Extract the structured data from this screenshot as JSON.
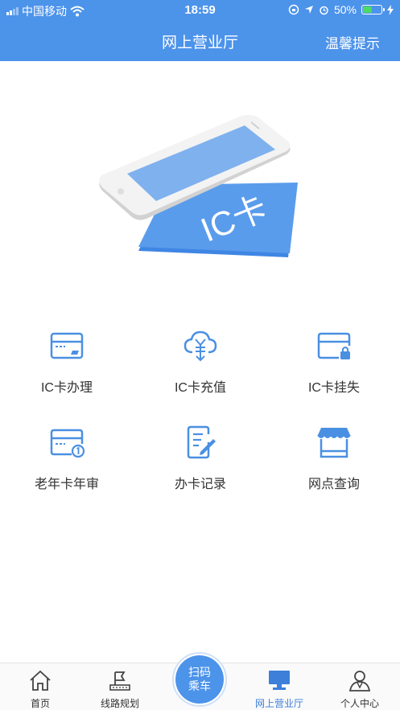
{
  "status_bar": {
    "carrier": "中国移动",
    "time": "18:59",
    "battery": "50%",
    "battery_level": 0.5
  },
  "header": {
    "title": "网上营业厅",
    "tip_button": "温馨提示"
  },
  "hero": {
    "card_text": "IC卡"
  },
  "services": [
    {
      "label": "IC卡办理",
      "icon": "card-icon"
    },
    {
      "label": "IC卡充值",
      "icon": "cloud-yen-icon"
    },
    {
      "label": "IC卡挂失",
      "icon": "card-lock-icon"
    },
    {
      "label": "老年卡年审",
      "icon": "card-clock-icon"
    },
    {
      "label": "办卡记录",
      "icon": "document-edit-icon"
    },
    {
      "label": "网点查询",
      "icon": "store-icon"
    }
  ],
  "tabbar": {
    "items": [
      {
        "label": "首页",
        "icon": "home-icon"
      },
      {
        "label": "线路规划",
        "icon": "flag-icon"
      },
      {
        "label": "网上营业厅",
        "icon": "monitor-icon",
        "active": true
      },
      {
        "label": "个人中心",
        "icon": "person-icon"
      }
    ],
    "scan_line1": "扫码",
    "scan_line2": "乘车"
  },
  "colors": {
    "primary": "#4c93ea",
    "icon": "#4a90e2",
    "active_tab": "#3d7fd9"
  }
}
